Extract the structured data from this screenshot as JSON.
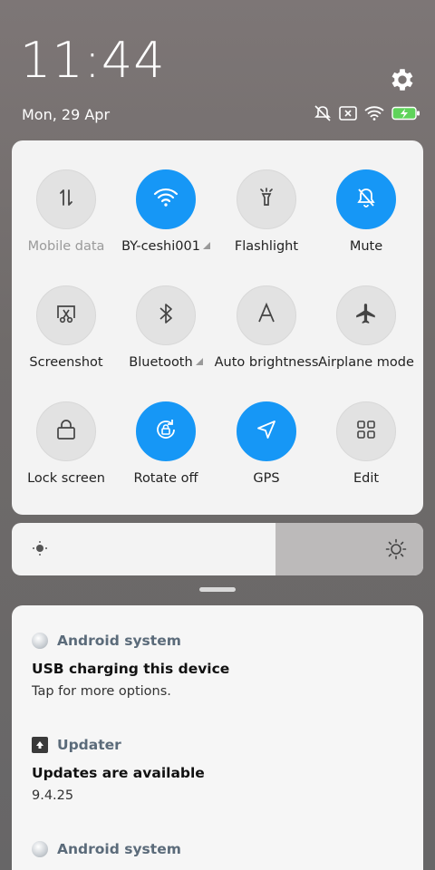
{
  "status_bar": {
    "time": "11:44",
    "date": "Mon, 29 Apr",
    "icons": [
      "silent-off-icon",
      "sim-off-icon",
      "wifi-icon",
      "battery-charging-icon"
    ]
  },
  "colors": {
    "accent": "#1697f6",
    "tile_off": "#e2e2e2",
    "panel": "#f3f3f3"
  },
  "tiles": [
    {
      "label": "Mobile data",
      "icon": "mobile-data-icon",
      "on": false,
      "dim": true
    },
    {
      "label": "BY-ceshi001",
      "icon": "wifi-icon",
      "on": true,
      "dim": false
    },
    {
      "label": "Flashlight",
      "icon": "flashlight-icon",
      "on": false,
      "dim": false
    },
    {
      "label": "Mute",
      "icon": "mute-icon",
      "on": true,
      "dim": false
    },
    {
      "label": "Screenshot",
      "icon": "screenshot-icon",
      "on": false,
      "dim": false
    },
    {
      "label": "Bluetooth",
      "icon": "bluetooth-icon",
      "on": false,
      "dim": false
    },
    {
      "label": "Auto brightness",
      "icon": "auto-brightness-icon",
      "on": false,
      "dim": false
    },
    {
      "label": "Airplane mode",
      "icon": "airplane-icon",
      "on": false,
      "dim": false
    },
    {
      "label": "Lock screen",
      "icon": "lock-icon",
      "on": false,
      "dim": false
    },
    {
      "label": "Rotate off",
      "icon": "rotate-lock-icon",
      "on": true,
      "dim": false
    },
    {
      "label": "GPS",
      "icon": "gps-icon",
      "on": true,
      "dim": false
    },
    {
      "label": "Edit",
      "icon": "grid-icon",
      "on": false,
      "dim": false
    }
  ],
  "brightness": {
    "level": 0.64
  },
  "notifications": [
    {
      "app": "Android system",
      "title": "USB charging this device",
      "text": "Tap for more options."
    },
    {
      "app": "Updater",
      "title": "Updates are available",
      "text": "9.4.25"
    },
    {
      "app": "Android system",
      "title": "",
      "text": ""
    }
  ]
}
